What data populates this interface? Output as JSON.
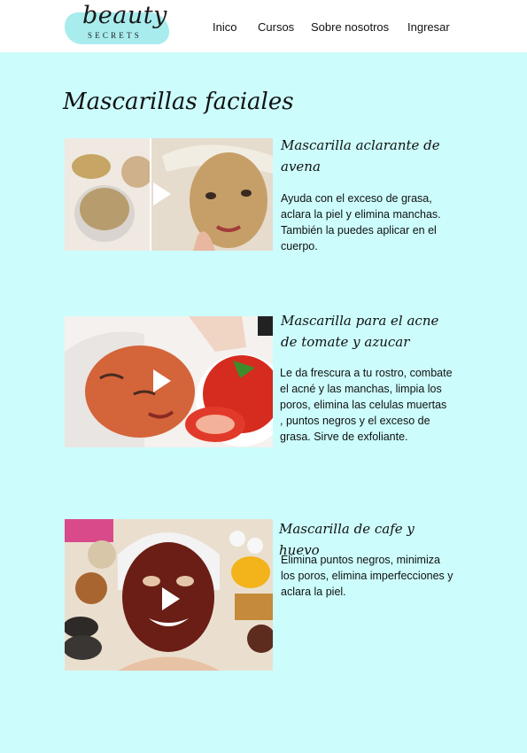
{
  "brand": {
    "name": "beauty",
    "subtitle": "SECRETS"
  },
  "nav": {
    "items": [
      {
        "label": "Inico"
      },
      {
        "label": "Cursos"
      },
      {
        "label": "Sobre nosotros"
      },
      {
        "label": "Ingresar"
      }
    ]
  },
  "main": {
    "title": "Mascarillas faciales",
    "cards": [
      {
        "title": "Mascarilla aclarante de avena",
        "description": "Ayuda con el exceso de grasa, aclara la piel y elimina manchas. También la puedes aplicar en el cuerpo."
      },
      {
        "title": "Mascarilla para el acne de tomate y azucar",
        "description": "Le da frescura a tu rostro, combate el acné y las manchas, limpia los poros, elimina las celulas muertas , puntos negros y el exceso de grasa. Sirve de exfoliante."
      },
      {
        "title": "Mascarilla de cafe y huevo",
        "description": "Elimina puntos negros, minimiza los poros, elimina imperfecciones y aclara la piel."
      }
    ]
  },
  "colors": {
    "background": "#ccfcfc",
    "header": "#ffffff",
    "logo_splash": "#a9ecee"
  }
}
